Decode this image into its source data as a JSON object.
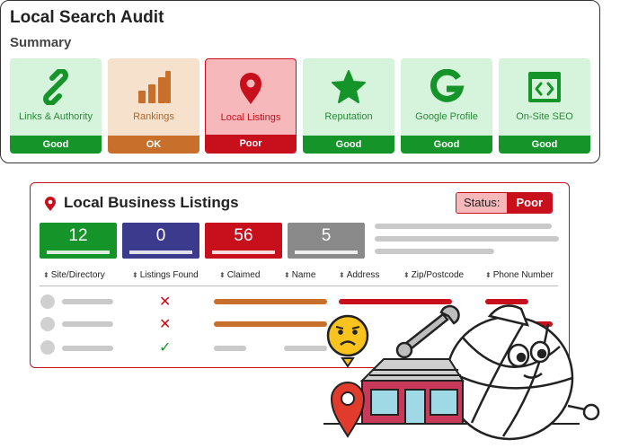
{
  "audit": {
    "title": "Local Search Audit",
    "subtitle": "Summary",
    "tiles": [
      {
        "label": "Links & Authority",
        "status": "Good",
        "icon": "link-icon"
      },
      {
        "label": "Rankings",
        "status": "OK",
        "icon": "bar-chart-icon"
      },
      {
        "label": "Local Listings",
        "status": "Poor",
        "icon": "map-pin-icon"
      },
      {
        "label": "Reputation",
        "status": "Good",
        "icon": "star-icon"
      },
      {
        "label": "Google Profile",
        "status": "Good",
        "icon": "google-g-icon"
      },
      {
        "label": "On-Site SEO",
        "status": "Good",
        "icon": "code-window-icon"
      }
    ]
  },
  "listings": {
    "title": "Local Business Listings",
    "status_label": "Status:",
    "status_value": "Poor",
    "stats": [
      {
        "value": "12",
        "color": "#15942a"
      },
      {
        "value": "0",
        "color": "#3b3a8c"
      },
      {
        "value": "56",
        "color": "#c8101c"
      },
      {
        "value": "5",
        "color": "#8a8a8a"
      }
    ],
    "columns": [
      "Site/Directory",
      "Listings Found",
      "Claimed",
      "Name",
      "Address",
      "Zip/Postcode",
      "Phone Number"
    ],
    "rows": [
      {
        "found": "✕",
        "found_ok": false
      },
      {
        "found": "✕",
        "found_ok": false
      },
      {
        "found": "✓",
        "found_ok": true
      }
    ]
  },
  "colors": {
    "good": "#15942a",
    "ok": "#c8702b",
    "poor": "#c8101c"
  }
}
